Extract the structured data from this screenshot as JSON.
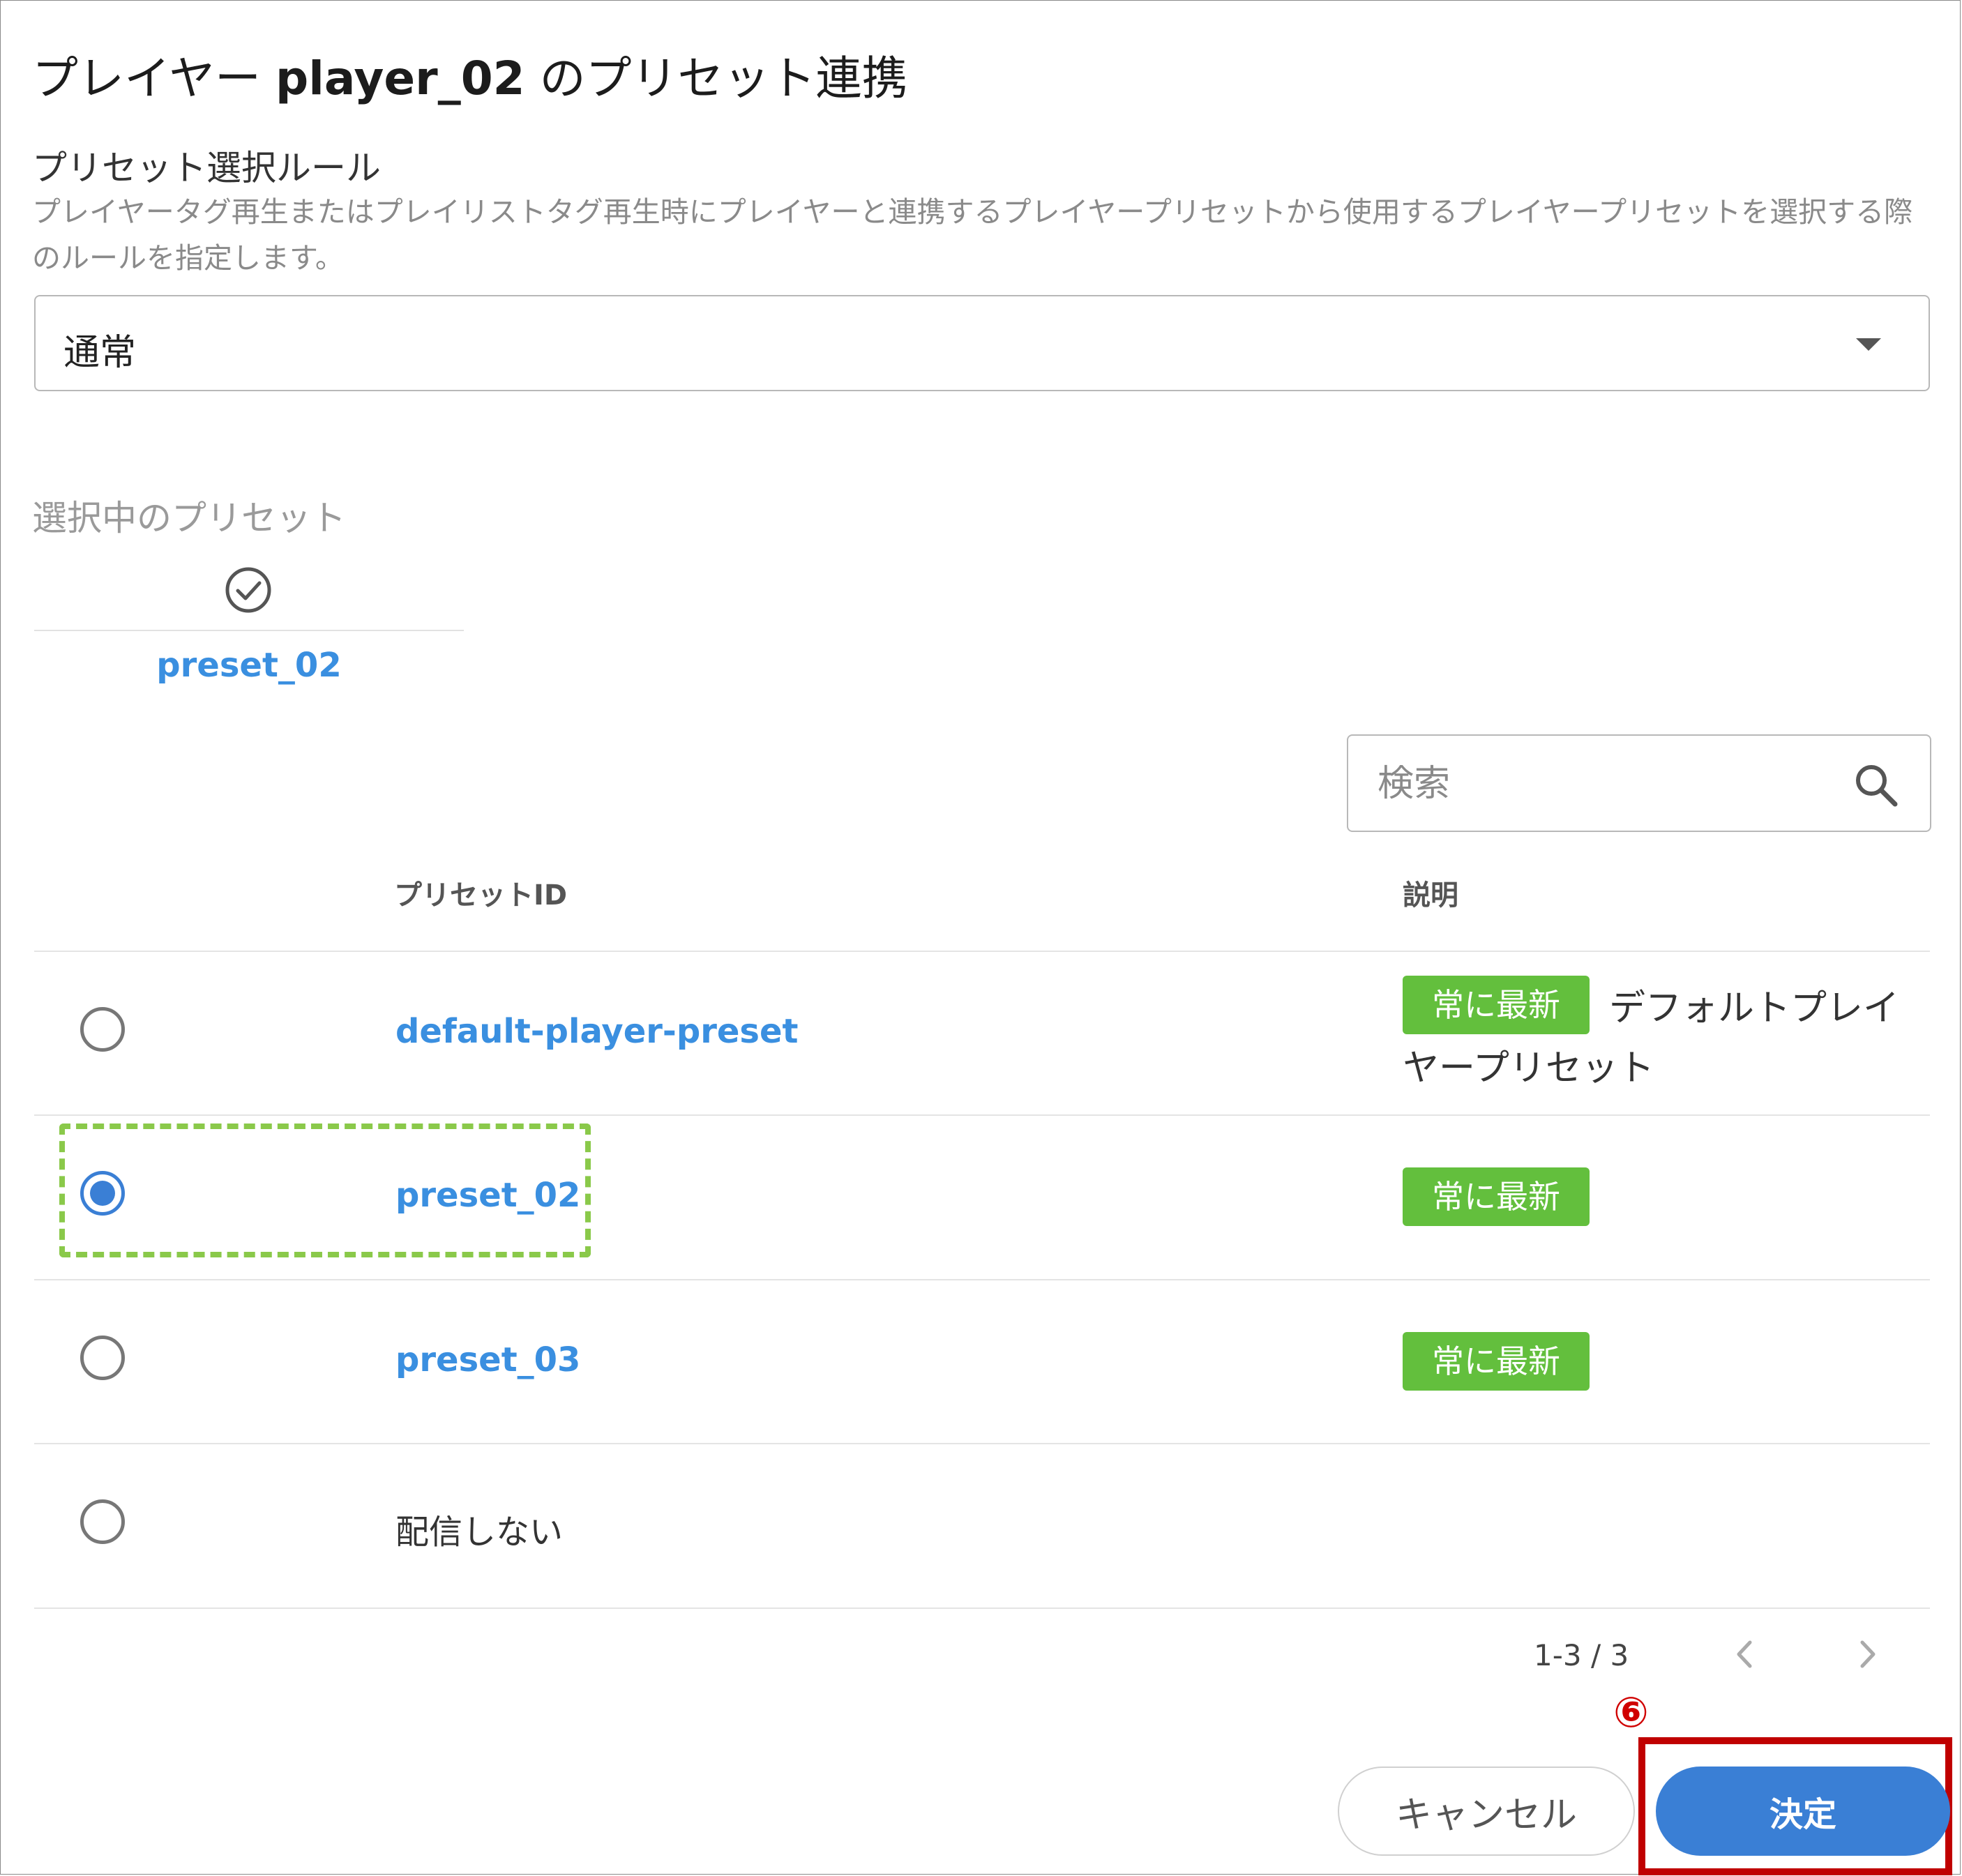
{
  "dialog": {
    "title_prefix": "プレイヤー",
    "title_player": "player_02",
    "title_suffix": "のプリセット連携"
  },
  "rule": {
    "label": "プリセット選択ルール",
    "description": "プレイヤータグ再生またはプレイリストタグ再生時にプレイヤーと連携するプレイヤープリセットから使用するプレイヤープリセットを選択する際のルールを指定します。",
    "selected_value": "通常"
  },
  "selected_preset": {
    "label": "選択中のプリセット",
    "value": "preset_02"
  },
  "search": {
    "placeholder": "検索"
  },
  "table": {
    "columns": {
      "id": "プリセットID",
      "description": "説明"
    },
    "rows": [
      {
        "id": "default-player-preset",
        "badge": "常に最新",
        "description_line1": "デフォルトプレイ",
        "description_line2": "ヤープリセット",
        "checked": false
      },
      {
        "id": "preset_02",
        "badge": "常に最新",
        "description": "",
        "checked": true
      },
      {
        "id": "preset_03",
        "badge": "常に最新",
        "description": "",
        "checked": false
      },
      {
        "id": "配信しない",
        "badge": "",
        "description": "",
        "checked": false
      }
    ]
  },
  "pagination": {
    "range": "1-3 / 3"
  },
  "annotation": {
    "step": "⑥"
  },
  "buttons": {
    "cancel": "キャンセル",
    "confirm": "決定"
  },
  "colors": {
    "link": "#3a8fe0",
    "badge": "#63bf3d",
    "primary": "#3a7fd5",
    "highlight_dashed": "#8ac94a",
    "annotation_red": "#c00000"
  }
}
